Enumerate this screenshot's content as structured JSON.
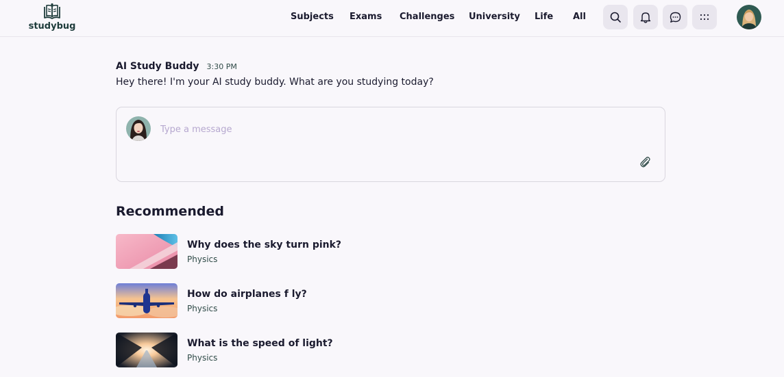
{
  "brand": {
    "name": "studybug",
    "logo_icon": "book-logo-icon"
  },
  "nav": {
    "items": [
      {
        "label": "Subjects"
      },
      {
        "label": "Exams"
      },
      {
        "label": "Challenges"
      },
      {
        "label": "University"
      },
      {
        "label": "Life"
      },
      {
        "label": "All"
      }
    ]
  },
  "header_icons": [
    "search-icon",
    "bell-icon",
    "chat-bubble-icon",
    "grid-dots-icon"
  ],
  "conversation": {
    "author": "AI Study Buddy",
    "time": "3:30 PM",
    "text": "Hey there! I'm your AI study buddy. What are you studying today?"
  },
  "composer": {
    "placeholder": "Type a message",
    "value": ""
  },
  "recommended": {
    "title": "Recommended",
    "items": [
      {
        "question": "Why does the sky turn pink?",
        "subject": "Physics"
      },
      {
        "question": "How do airplanes f ly?",
        "subject": "Physics"
      },
      {
        "question": "What is the speed of light?",
        "subject": "Physics"
      }
    ]
  },
  "colors": {
    "background": "#f9f7fb",
    "text": "#1a1a2e",
    "icon_button_bg": "#e9e6ee",
    "placeholder": "#b6a8cf",
    "brand": "#1d3b3a"
  }
}
